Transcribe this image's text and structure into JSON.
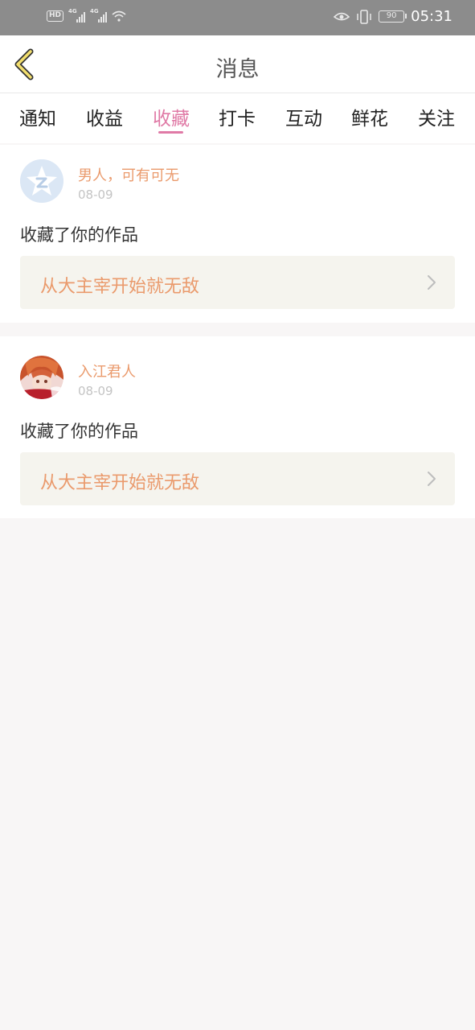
{
  "status_bar": {
    "network_badge": "HD",
    "signal1_label": "4G",
    "signal2_label": "4G",
    "battery": "90",
    "time": "05:31"
  },
  "header": {
    "title": "消息"
  },
  "tabs": [
    {
      "label": "通知"
    },
    {
      "label": "收益"
    },
    {
      "label": "收藏"
    },
    {
      "label": "打卡"
    },
    {
      "label": "互动"
    },
    {
      "label": "鲜花"
    },
    {
      "label": "关注"
    }
  ],
  "active_tab": "收藏",
  "messages": [
    {
      "user": "男人，可有可无",
      "date": "08-09",
      "action": "收藏了你的作品",
      "work_title": "从大主宰开始就无敌"
    },
    {
      "user": "入江君人",
      "date": "08-09",
      "action": "收藏了你的作品",
      "work_title": "从大主宰开始就无敌"
    }
  ],
  "colors": {
    "accent": "#e07aa6",
    "username": "#ea9a6c",
    "work_bg": "#f5f4ee",
    "page_bg": "#f8f6f6"
  }
}
